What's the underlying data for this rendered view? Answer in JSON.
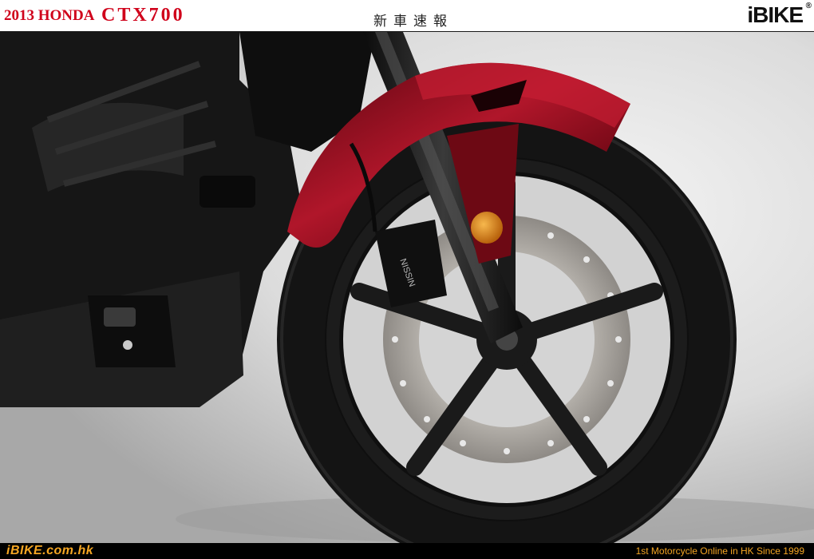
{
  "header": {
    "title_prefix": "2013 HONDA",
    "title_model": "CTX700",
    "center_text": "新車速報",
    "brand_logo": "iBIKE",
    "brand_reg_mark": "®"
  },
  "photo": {
    "subject": "motorcycle-front-wheel",
    "caliper_label": "NISSIN",
    "colors": {
      "fender": "#8e0c1c",
      "tire": "#141414",
      "background": "#dadada"
    }
  },
  "footer": {
    "site": "iBIKE.com.hk",
    "tagline": "1st  Motorcycle Online in HK Since 1999"
  },
  "colors": {
    "title_red": "#d0021b",
    "footer_accent": "#f5a623"
  }
}
